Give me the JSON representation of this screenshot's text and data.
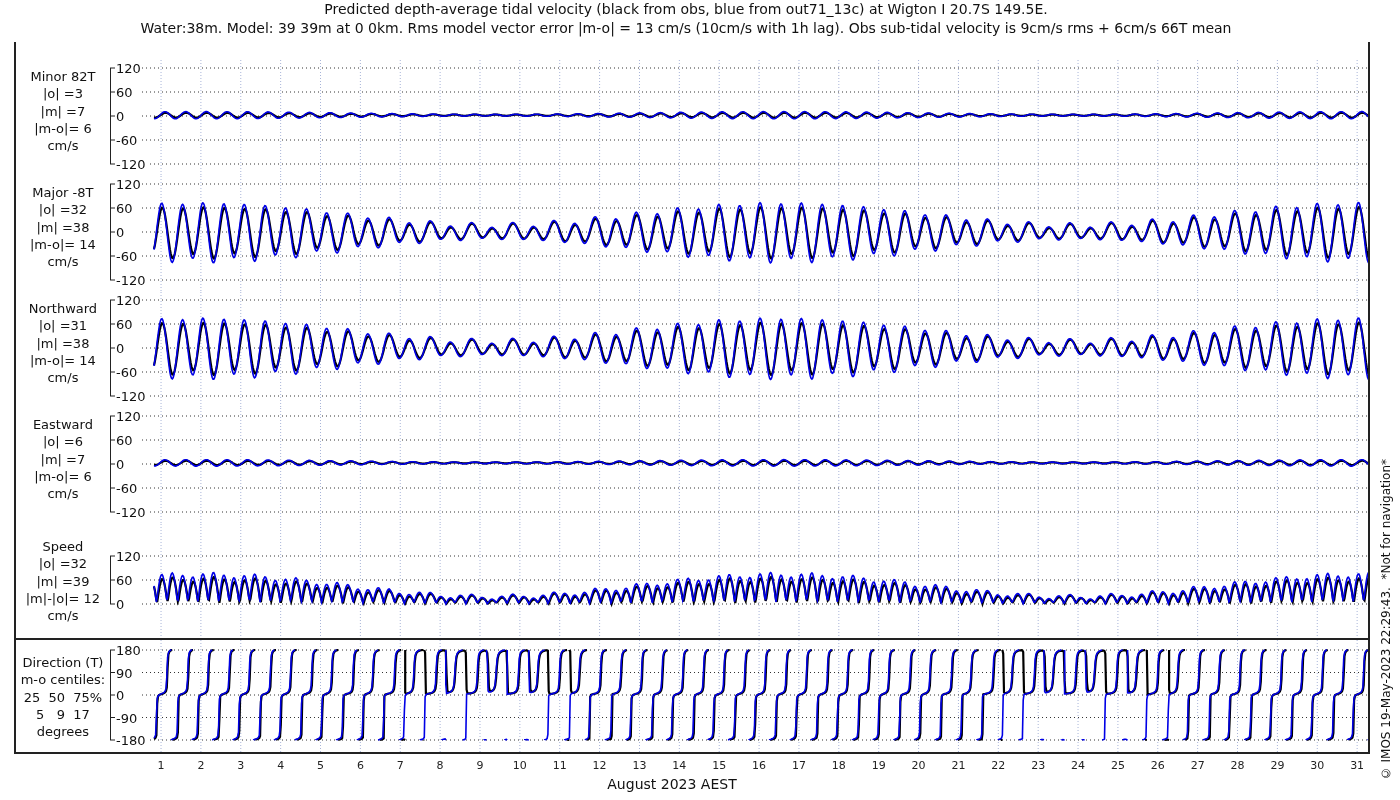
{
  "title_lines": [
    "Predicted depth-average tidal velocity (black from obs, blue from out71_13c) at Wigton I 20.7S 149.5E.",
    "Water:38m. Model: 39 39m at 0 0km. Rms model vector error |m-o| = 13 cm/s (10cm/s with 1h lag). Obs sub-tidal velocity is 9cm/s rms + 6cm/s 66T mean"
  ],
  "panels": [
    {
      "kind": "minor",
      "label_lines": [
        "Minor 82T",
        "|o| =3",
        "|m| =7",
        "|m-o|= 6",
        "cm/s"
      ],
      "yticks": [
        "120",
        "60",
        "0",
        "-60",
        "-120"
      ]
    },
    {
      "kind": "major",
      "label_lines": [
        "Major -8T",
        "|o| =32",
        "|m| =38",
        "|m-o|= 14",
        "cm/s"
      ],
      "yticks": [
        "120",
        "60",
        "0",
        "-60",
        "-120"
      ]
    },
    {
      "kind": "northward",
      "label_lines": [
        "Northward",
        "|o| =31",
        "|m| =38",
        "|m-o|= 14",
        "cm/s"
      ],
      "yticks": [
        "120",
        "60",
        "0",
        "-60",
        "-120"
      ]
    },
    {
      "kind": "eastward",
      "label_lines": [
        "Eastward",
        "|o| =6",
        "|m| =7",
        "|m-o|= 6",
        "cm/s"
      ],
      "yticks": [
        "120",
        "60",
        "0",
        "-60",
        "-120"
      ]
    },
    {
      "kind": "speed",
      "label_lines": [
        "Speed",
        "|o| =32",
        "|m| =39",
        "|m|-|o|= 12",
        "cm/s"
      ],
      "yticks": [
        "120",
        "60",
        "0"
      ]
    },
    {
      "kind": "direction",
      "label_lines": [
        "Direction (T)",
        "m-o centiles:",
        "25  50  75%",
        "5   9  17",
        "degrees"
      ],
      "yticks": [
        "180",
        "90",
        "0",
        "-90",
        "-180"
      ]
    }
  ],
  "xticks": [
    "1",
    "2",
    "3",
    "4",
    "5",
    "6",
    "7",
    "8",
    "9",
    "10",
    "11",
    "12",
    "13",
    "14",
    "15",
    "16",
    "17",
    "18",
    "19",
    "20",
    "21",
    "22",
    "23",
    "24",
    "25",
    "26",
    "27",
    "28",
    "29",
    "30",
    "31"
  ],
  "xlabel": "August 2023 AEST",
  "note": "© IMOS 19-May-2023 22:29:43.  *Not for navigation*"
}
